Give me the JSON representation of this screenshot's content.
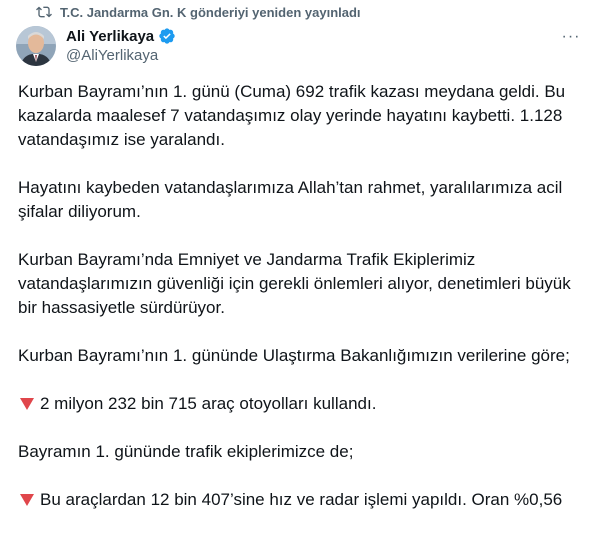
{
  "repost": {
    "text": "T.C. Jandarma Gn. K gönderiyi yeniden yayınladı",
    "icon": "repost-icon"
  },
  "author": {
    "name": "Ali Yerlikaya",
    "handle": "@AliYerlikaya",
    "verified_color": "#1d9bf0"
  },
  "more_label": "···",
  "tweet": {
    "paragraphs": [
      "Kurban Bayramı’nın 1. günü (Cuma) 692 trafik kazası meydana geldi. Bu kazalarda maalesef 7 vatandaşımız olay yerinde hayatını kaybetti. 1.128 vatandaşımız ise yaralandı.",
      "Hayatını kaybeden vatandaşlarımıza Allah’tan rahmet, yaralılarımıza acil şifalar diliyorum.",
      "Kurban Bayramı’nda Emniyet ve Jandarma Trafik Ekiplerimiz vatandaşlarımızın güvenliği için gerekli önlemleri alıyor, denetimleri büyük bir hassasiyetle sürdürüyor.",
      "Kurban Bayramı’nın 1. gününde Ulaştırma Bakanlığımızın verilerine göre;"
    ],
    "bullet1": "2 milyon 232 bin 715 araç otoyolları kullandı.",
    "middle": "Bayramın 1. gününde trafik ekiplerimizce de;",
    "bullet2": "Bu araçlardan 12 bin 407’sine hız ve radar işlemi yapıldı. Oran %0,56",
    "bullet_icon": "red-triangle-down-icon"
  }
}
